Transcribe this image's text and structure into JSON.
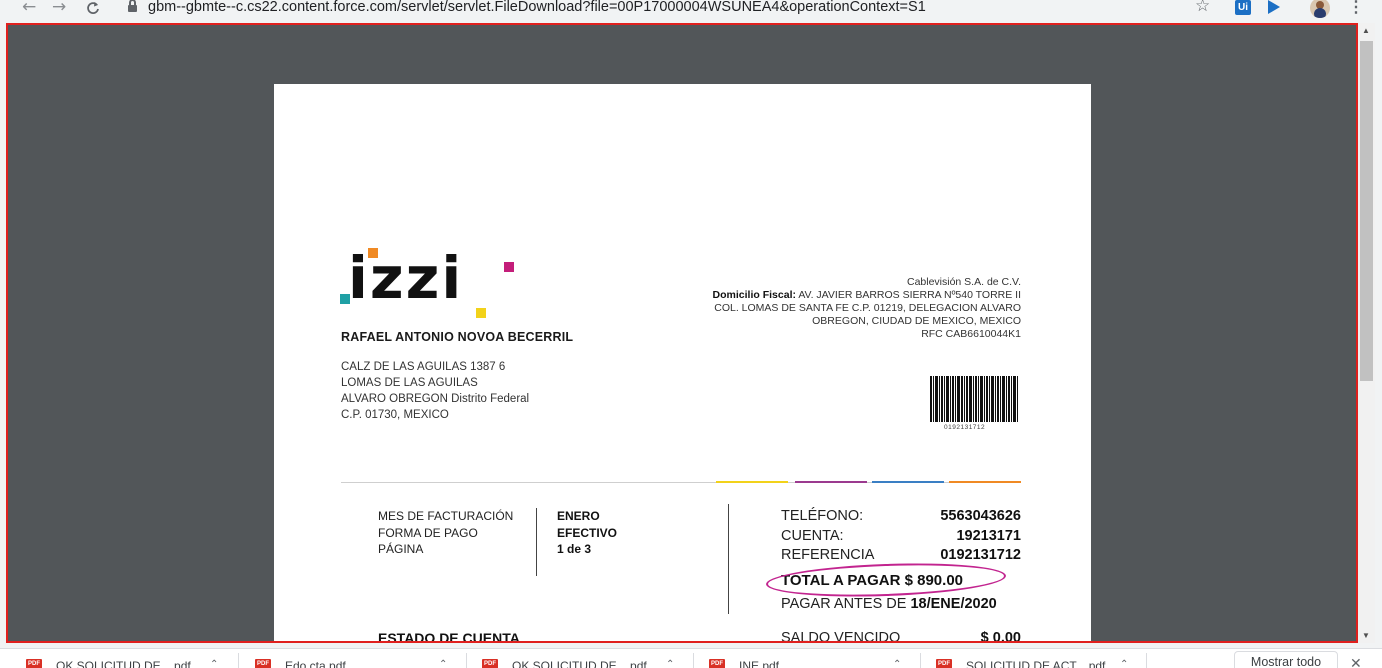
{
  "browser": {
    "back": "←",
    "forward": "→",
    "reload": "C",
    "url": "gbm--gbmte--c.cs22.content.force.com/servlet/servlet.FileDownload?file=00P17000004WSUNEA4&operationContext=S1",
    "star": "☆",
    "ext_ui_label": "Ui",
    "menu": "⋮"
  },
  "document": {
    "logo_text": "izzi",
    "customer": {
      "name": "RAFAEL ANTONIO NOVOA BECERRIL",
      "address_line1": "CALZ DE LAS AGUILAS 1387 6",
      "address_line2": "LOMAS DE LAS AGUILAS",
      "address_line3": "ALVARO OBREGON Distrito Federal",
      "address_line4": "C.P. 01730, MEXICO"
    },
    "company": {
      "name": "Cablevisión S.A. de C.V.",
      "fiscal_label": "Domicilio Fiscal:",
      "fiscal_line1": "AV. JAVIER BARROS SIERRA Nº540 TORRE II",
      "fiscal_line2": "COL. LOMAS DE SANTA FE C.P. 01219, DELEGACION ALVARO",
      "fiscal_line3": "OBREGON, CIUDAD DE MEXICO, MEXICO",
      "rfc": "RFC CAB6610044K1"
    },
    "barcode_number": "0192131712",
    "billing": {
      "month_label": "MES DE FACTURACIÓN",
      "payment_label": "FORMA DE PAGO",
      "page_label": "PÁGINA",
      "month_value": "ENERO",
      "payment_value": "EFECTIVO",
      "page_value": "1 de 3"
    },
    "account": {
      "phone_label": "TELÉFONO:",
      "phone_value": "5563043626",
      "account_label": "CUENTA:",
      "account_value": "19213171",
      "reference_label": "REFERENCIA",
      "reference_value": "0192131712",
      "total_label": "TOTAL A PAGAR $ 890.00",
      "due_label": "PAGAR ANTES DE",
      "due_value": "18/ENE/2020",
      "overdue_label": "SALDO VENCIDO",
      "overdue_value": "$ 0.00"
    },
    "statement_title": "ESTADO DE CUENTA"
  },
  "downloads": {
    "items": [
      {
        "name": "OK SOLICITUD DE....pdf"
      },
      {
        "name": "Edo cta.pdf"
      },
      {
        "name": "OK SOLICITUD DE....pdf"
      },
      {
        "name": "INE.pdf"
      },
      {
        "name": "SOLICITUD DE ACT....pdf"
      }
    ],
    "show_all": "Mostrar todo",
    "close": "✕"
  },
  "colors": {
    "viewer_border": "#e0201e",
    "viewer_bg": "#525659",
    "highlight_ellipse": "#c2248f",
    "izzi_orange": "#f08a24",
    "izzi_magenta": "#c41e7a",
    "izzi_teal": "#1fa0a5",
    "izzi_yellow": "#f2d21a"
  }
}
